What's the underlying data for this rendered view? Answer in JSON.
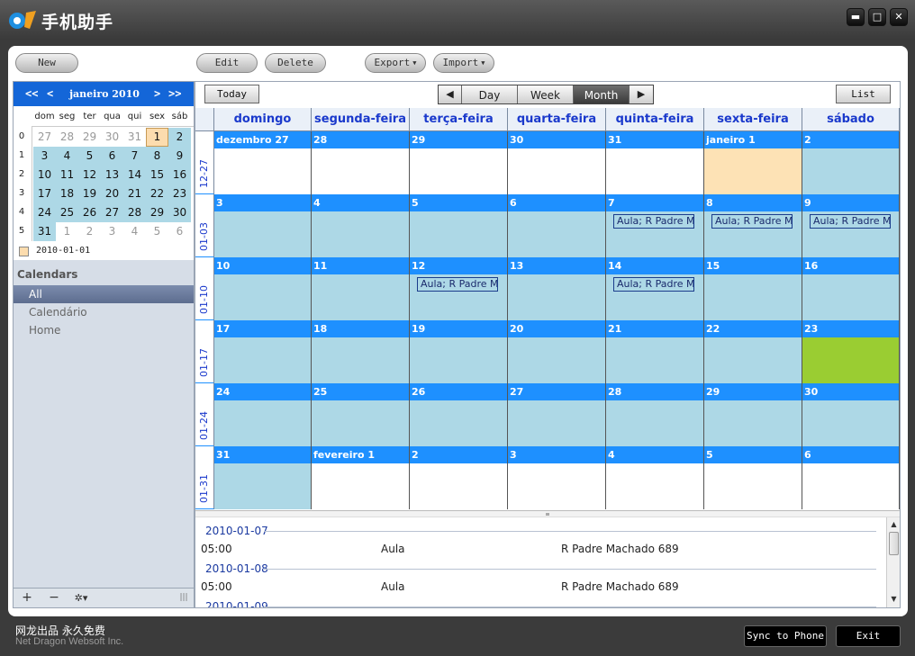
{
  "window": {
    "title": "手机助手",
    "min_glyph": "▬",
    "max_glyph": "□",
    "close_glyph": "✕"
  },
  "toolbar": {
    "new": "New",
    "edit": "Edit",
    "delete": "Delete",
    "export": "Export",
    "import": "Import"
  },
  "mini_calendar": {
    "prev_year": "<<",
    "prev_month": "<",
    "title": "janeiro 2010",
    "next_month": ">",
    "next_year": ">>",
    "weekdays": [
      "dom",
      "seg",
      "ter",
      "qua",
      "qui",
      "sex",
      "sáb"
    ],
    "week_numbers": [
      "0",
      "1",
      "2",
      "3",
      "4",
      "5"
    ],
    "weeks": [
      [
        "27",
        "28",
        "29",
        "30",
        "31",
        "1",
        "2"
      ],
      [
        "3",
        "4",
        "5",
        "6",
        "7",
        "8",
        "9"
      ],
      [
        "10",
        "11",
        "12",
        "13",
        "14",
        "15",
        "16"
      ],
      [
        "17",
        "18",
        "19",
        "20",
        "21",
        "22",
        "23"
      ],
      [
        "24",
        "25",
        "26",
        "27",
        "28",
        "29",
        "30"
      ],
      [
        "31",
        "1",
        "2",
        "3",
        "4",
        "5",
        "6"
      ]
    ],
    "legend_date": "2010-01-01"
  },
  "calendars": {
    "title": "Calendars",
    "items": [
      "All",
      "Calendário",
      "Home"
    ]
  },
  "left_bottom": {
    "add": "+",
    "remove": "−",
    "settings": "✲▾",
    "grip": "|||"
  },
  "view": {
    "today": "Today",
    "prev": "◀",
    "day": "Day",
    "week": "Week",
    "month": "Month",
    "next": "▶",
    "list": "List"
  },
  "month": {
    "days_of_week": [
      "domingo",
      "segunda-feira",
      "terça-feira",
      "quarta-feira",
      "quinta-feira",
      "sexta-feira",
      "sábado"
    ],
    "week_labels": [
      "12-27",
      "01-03",
      "01-10",
      "01-17",
      "01-24",
      "01-31"
    ],
    "weeks": [
      [
        "dezembro 27",
        "28",
        "29",
        "30",
        "31",
        "janeiro 1",
        "2"
      ],
      [
        "3",
        "4",
        "5",
        "6",
        "7",
        "8",
        "9"
      ],
      [
        "10",
        "11",
        "12",
        "13",
        "14",
        "15",
        "16"
      ],
      [
        "17",
        "18",
        "19",
        "20",
        "21",
        "22",
        "23"
      ],
      [
        "24",
        "25",
        "26",
        "27",
        "28",
        "29",
        "30"
      ],
      [
        "31",
        "fevereiro 1",
        "2",
        "3",
        "4",
        "5",
        "6"
      ]
    ],
    "event_label": "Aula; R Padre M"
  },
  "list": {
    "groups": [
      {
        "date": "2010-01-07",
        "time": "05:00",
        "title": "Aula",
        "location": "R Padre Machado 689"
      },
      {
        "date": "2010-01-08",
        "time": "05:00",
        "title": "Aula",
        "location": "R Padre Machado 689"
      },
      {
        "date": "2010-01-09",
        "time": "",
        "title": "",
        "location": ""
      }
    ]
  },
  "footer": {
    "cn": "网龙出品 永久免费",
    "en": "Net Dragon Websoft Inc.",
    "sync": "Sync to Phone",
    "exit": "Exit"
  },
  "colors": {
    "accent": "#1e90ff",
    "day_fill": "#add8e6",
    "selected_fill": "#fde2b5",
    "today_fill": "#9acd32",
    "header_text": "#1a39cc"
  }
}
